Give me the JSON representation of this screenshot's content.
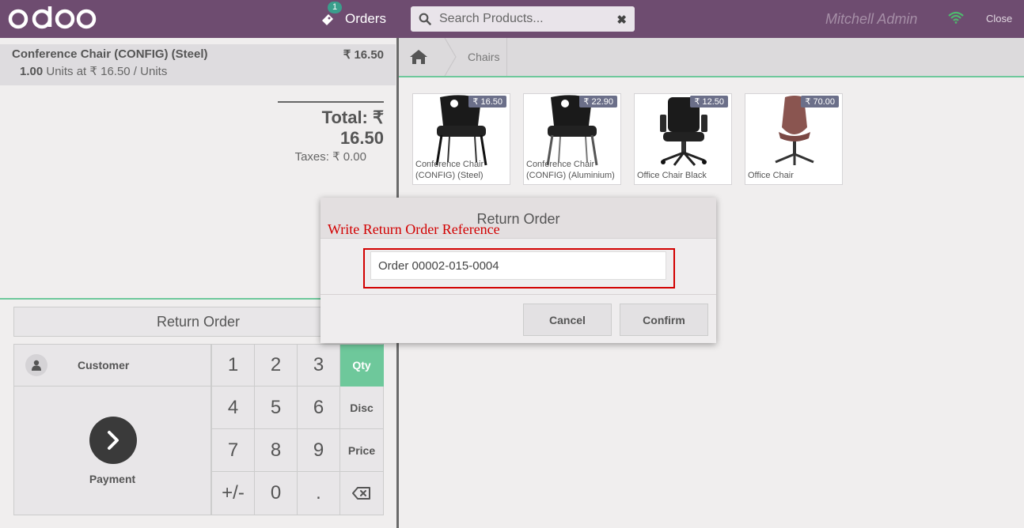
{
  "header": {
    "logo_text": "odoo",
    "orders_label": "Orders",
    "orders_count": "1",
    "search_placeholder": "Search Products...",
    "user_name": "Mitchell Admin",
    "close_label": "Close"
  },
  "order": {
    "line": {
      "product": "Conference Chair (CONFIG) (Steel)",
      "price": "₹ 16.50",
      "quantity": "1.00",
      "unit_detail": "Units at ₹ 16.50 / Units"
    },
    "total": "Total: ₹ 16.50",
    "taxes": "Taxes: ₹ 0.00"
  },
  "controls": {
    "return_order_label": "Return Order",
    "customer_label": "Customer",
    "payment_label": "Payment",
    "numpad": [
      "1",
      "2",
      "3",
      "Qty",
      "4",
      "5",
      "6",
      "Disc",
      "7",
      "8",
      "9",
      "Price",
      "+/-",
      "0",
      ".",
      "⌫"
    ],
    "active_mode": "Qty",
    "accent_color": "#6ec89b"
  },
  "breadcrumbs": {
    "category": "Chairs"
  },
  "products": [
    {
      "name": "Conference Chair (CONFIG) (Steel)",
      "price": "₹ 16.50",
      "icon": "chair-steel"
    },
    {
      "name": "Conference Chair (CONFIG) (Aluminium)",
      "price": "₹ 22.90",
      "icon": "chair-aluminium"
    },
    {
      "name": "Office Chair Black",
      "price": "₹ 12.50",
      "icon": "office-chair-black"
    },
    {
      "name": "Office Chair",
      "price": "₹ 70.00",
      "icon": "office-chair-brown"
    }
  ],
  "modal": {
    "title": "Return Order",
    "annotation": "Write Return Order Reference",
    "input_value": "Order 00002-015-0004",
    "cancel_label": "Cancel",
    "confirm_label": "Confirm",
    "annotation_color": "#d20000"
  }
}
